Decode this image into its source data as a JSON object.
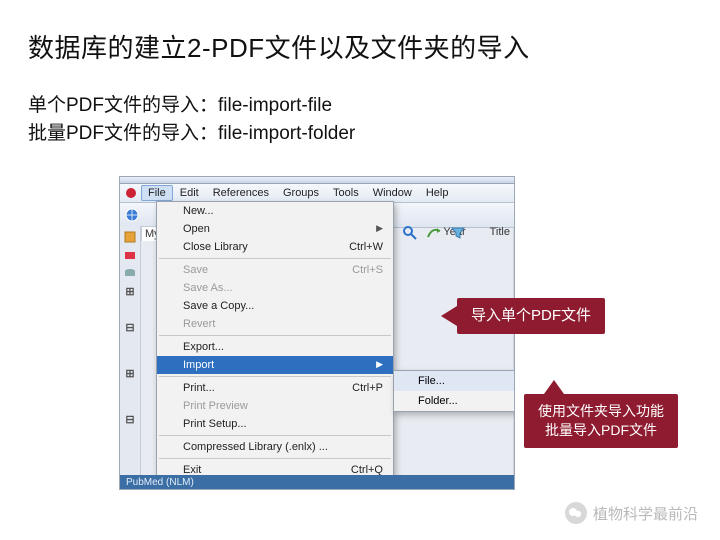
{
  "title": "数据库的建立2-PDF文件以及文件夹的导入",
  "line1": "单个PDF文件的导入：file-import-file",
  "line2": "批量PDF文件的导入：file-import-folder",
  "menubar": {
    "items": [
      "File",
      "Edit",
      "References",
      "Groups",
      "Tools",
      "Window",
      "Help"
    ]
  },
  "columns": {
    "year": "Year",
    "title": "Title"
  },
  "my_tab": "My",
  "file_menu": {
    "new": "New...",
    "open": "Open",
    "close_library": "Close Library",
    "close_library_sc": "Ctrl+W",
    "save": "Save",
    "save_sc": "Ctrl+S",
    "save_as": "Save As...",
    "save_copy": "Save a Copy...",
    "revert": "Revert",
    "export": "Export...",
    "import": "Import",
    "print": "Print...",
    "print_sc": "Ctrl+P",
    "print_preview": "Print Preview",
    "print_setup": "Print Setup...",
    "compressed": "Compressed Library (.enlx) ...",
    "exit": "Exit",
    "exit_sc": "Ctrl+Q"
  },
  "submenu": {
    "file": "File...",
    "folder": "Folder..."
  },
  "callout1": "导入单个PDF文件",
  "callout2_l1": "使用文件夹导入功能",
  "callout2_l2": "批量导入PDF文件",
  "status": "PubMed (NLM)",
  "watermark": "植物科学最前沿"
}
